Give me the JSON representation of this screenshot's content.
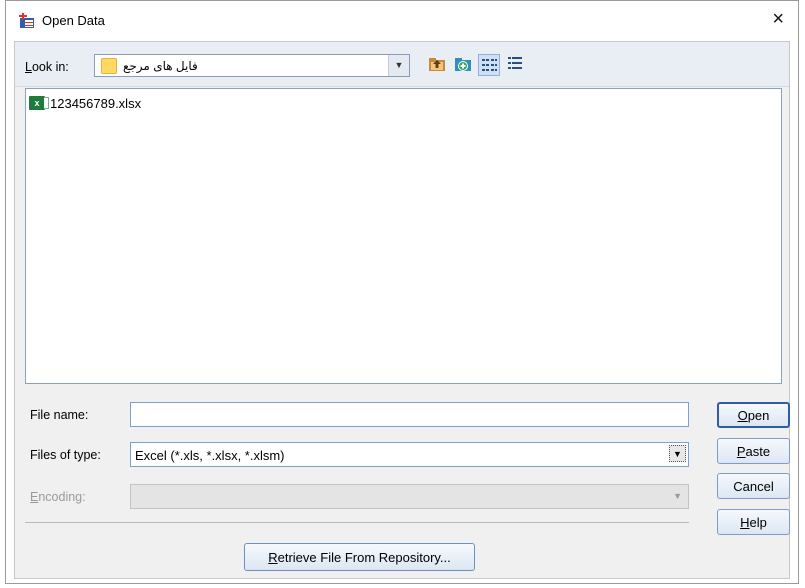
{
  "window": {
    "title": "Open Data",
    "close_glyph": "×"
  },
  "toolbar": {
    "lookin_label_u": "L",
    "lookin_label_rest": "ook in:",
    "lookin_value": "فایل های مرجع",
    "buttons": [
      "up-folder-icon",
      "new-folder-icon",
      "list-view-icon",
      "details-view-icon"
    ]
  },
  "files": [
    {
      "name": "123456789.xlsx",
      "icon": "excel-file-icon"
    }
  ],
  "form": {
    "file_name_label": "File name:",
    "file_name_value": "",
    "files_of_type_label": "Files of type:",
    "files_of_type_value": "Excel (*.xls, *.xlsx, *.xlsm)",
    "encoding_label_u": "E",
    "encoding_label_rest": "ncoding:",
    "encoding_value": ""
  },
  "buttons": {
    "open_u": "O",
    "open_rest": "pen",
    "paste_u": "P",
    "paste_rest": "aste",
    "cancel": "Cancel",
    "help_u": "H",
    "help_rest": "elp",
    "retrieve_u": "R",
    "retrieve_rest": "etrieve File From Repository..."
  },
  "colors": {
    "accent": "#2f5fa0",
    "toolbar_bg": "#e9eef5",
    "dialog_bg": "#f0f0f0"
  }
}
